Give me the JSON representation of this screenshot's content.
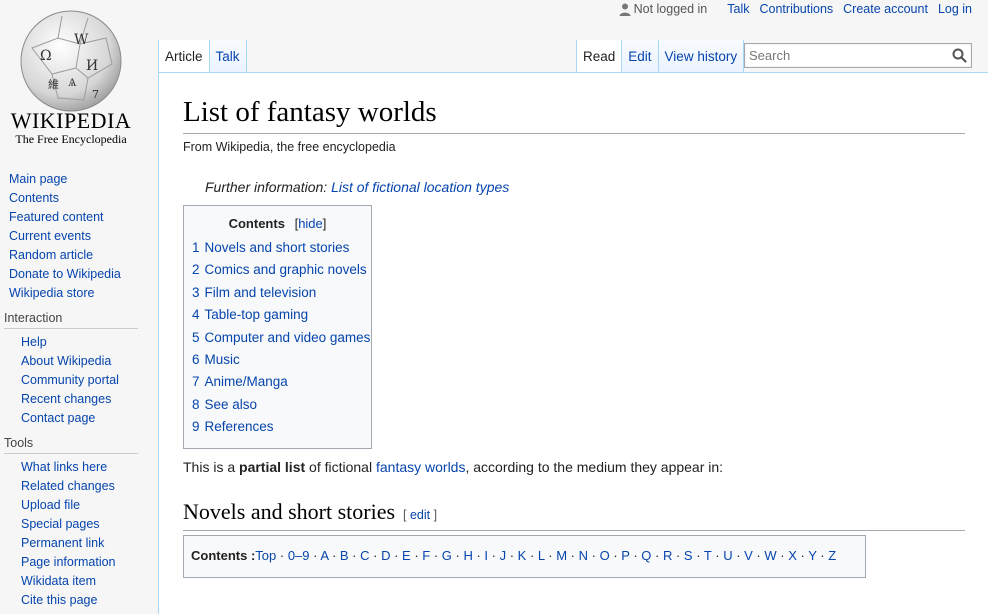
{
  "logo": {
    "wordmark": "WIKIPEDIA",
    "tagline": "The Free Encyclopedia",
    "glyphs": [
      "Ω",
      "W",
      "И",
      "維",
      "Ѧ",
      "7"
    ]
  },
  "personal": {
    "not_logged_in": "Not logged in",
    "talk": "Talk",
    "contributions": "Contributions",
    "create_account": "Create account",
    "log_in": "Log in"
  },
  "tabs": {
    "article": "Article",
    "talk": "Talk",
    "read": "Read",
    "edit": "Edit",
    "view_history": "View history"
  },
  "search": {
    "placeholder": "Search",
    "value": ""
  },
  "sidebar": {
    "main": [
      "Main page",
      "Contents",
      "Featured content",
      "Current events",
      "Random article",
      "Donate to Wikipedia",
      "Wikipedia store"
    ],
    "interaction": {
      "heading": "Interaction",
      "items": [
        "Help",
        "About Wikipedia",
        "Community portal",
        "Recent changes",
        "Contact page"
      ]
    },
    "tools": {
      "heading": "Tools",
      "items": [
        "What links here",
        "Related changes",
        "Upload file",
        "Special pages",
        "Permanent link",
        "Page information",
        "Wikidata item",
        "Cite this page"
      ]
    }
  },
  "article": {
    "title": "List of fantasy worlds",
    "site_sub": "From Wikipedia, the free encyclopedia",
    "hatnote_prefix": "Further information: ",
    "hatnote_link": "List of fictional location types",
    "toc": {
      "title": "Contents",
      "hide": "hide",
      "items": [
        {
          "num": "1",
          "label": "Novels and short stories"
        },
        {
          "num": "2",
          "label": "Comics and graphic novels"
        },
        {
          "num": "3",
          "label": "Film and television"
        },
        {
          "num": "4",
          "label": "Table-top gaming"
        },
        {
          "num": "5",
          "label": "Computer and video games"
        },
        {
          "num": "6",
          "label": "Music"
        },
        {
          "num": "7",
          "label": "Anime/Manga"
        },
        {
          "num": "8",
          "label": "See also"
        },
        {
          "num": "9",
          "label": "References"
        }
      ]
    },
    "intro": {
      "p1": "This is a ",
      "bold": "partial list",
      "p2": " of fictional ",
      "link": "fantasy worlds",
      "p3": ", according to the medium they appear in:"
    },
    "section1": {
      "title": "Novels and short stories",
      "edit": "edit"
    },
    "az": {
      "label": "Contents :",
      "items": [
        "Top",
        "0–9",
        "A",
        "B",
        "C",
        "D",
        "E",
        "F",
        "G",
        "H",
        "I",
        "J",
        "K",
        "L",
        "M",
        "N",
        "O",
        "P",
        "Q",
        "R",
        "S",
        "T",
        "U",
        "V",
        "W",
        "X",
        "Y",
        "Z"
      ]
    }
  },
  "colors": {
    "link": "#0645ad",
    "tab_border": "#a7d7f9",
    "page_bg": "#f6f6f6"
  }
}
